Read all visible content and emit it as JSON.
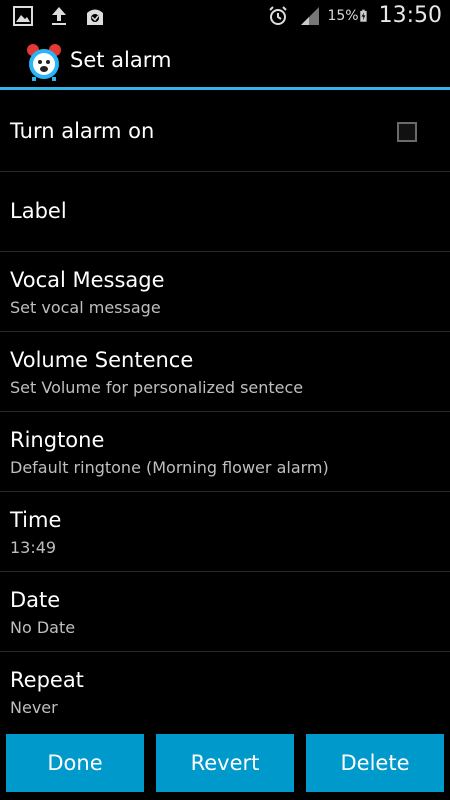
{
  "status_bar": {
    "icons_left": [
      "image-icon",
      "upload-icon",
      "shopping-bag-icon"
    ],
    "icons_right": [
      "alarm-clock-icon",
      "signal-icon",
      "battery-charging-icon"
    ],
    "battery_percent": "15%",
    "time": "13:50"
  },
  "action_bar": {
    "title": "Set alarm",
    "icon": "alarm-clock-app-icon"
  },
  "prefs": [
    {
      "title": "Turn alarm on",
      "summary": "",
      "checked": false
    },
    {
      "title": "Label",
      "summary": ""
    },
    {
      "title": "Vocal Message",
      "summary": "Set vocal message"
    },
    {
      "title": "Volume Sentence",
      "summary": "Set Volume for personalized sentece"
    },
    {
      "title": "Ringtone",
      "summary": "Default ringtone (Morning flower alarm)"
    },
    {
      "title": "Time",
      "summary": "13:49"
    },
    {
      "title": "Date",
      "summary": "No Date"
    },
    {
      "title": "Repeat",
      "summary": "Never"
    }
  ],
  "buttons": {
    "done": "Done",
    "revert": "Revert",
    "delete": "Delete"
  },
  "colors": {
    "accent": "#33b5e5",
    "button": "#0099cc"
  }
}
